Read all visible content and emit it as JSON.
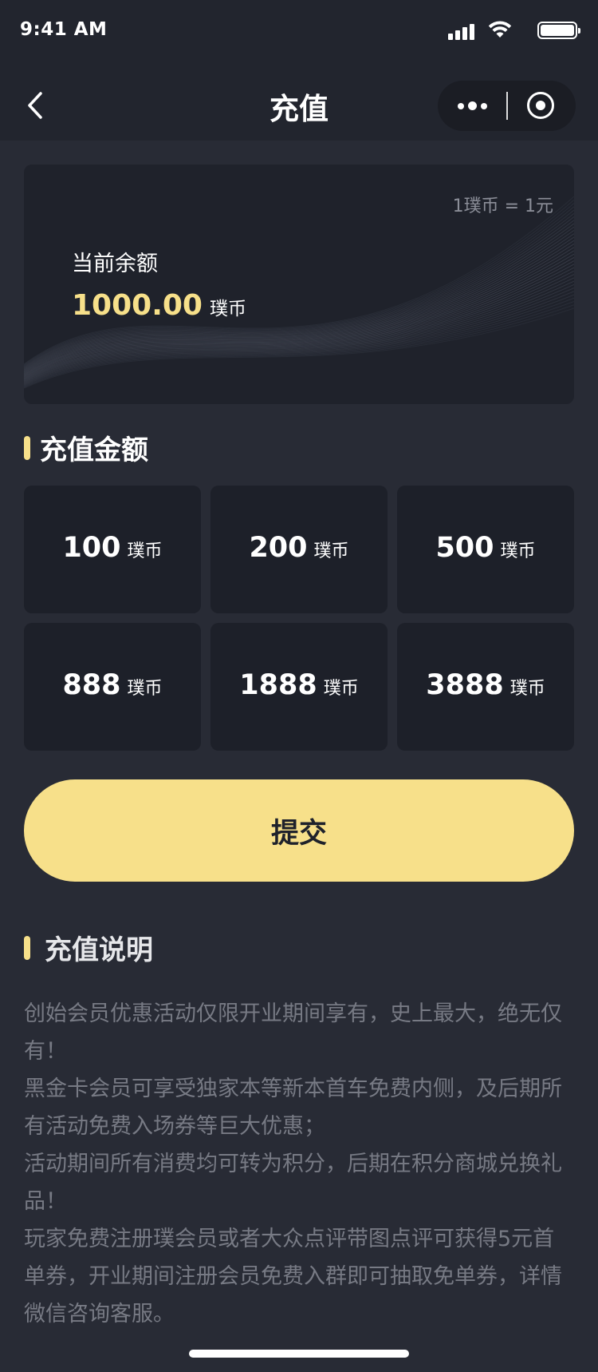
{
  "status_bar": {
    "time": "9:41 AM",
    "icons": [
      "signal-icon",
      "wifi-icon",
      "battery-icon"
    ]
  },
  "nav": {
    "title": "充值",
    "back_icon": "chevron-left-icon",
    "capsule_icons": [
      "more-icon",
      "close-circle-icon"
    ]
  },
  "balance": {
    "rate": "1璞币 = 1元",
    "label": "当前余额",
    "amount": "1000.00",
    "unit": "璞币"
  },
  "recharge_section": {
    "title": "充值金额",
    "options": [
      {
        "value": "100",
        "unit": "璞币"
      },
      {
        "value": "200",
        "unit": "璞币"
      },
      {
        "value": "500",
        "unit": "璞币"
      },
      {
        "value": "888",
        "unit": "璞币"
      },
      {
        "value": "1888",
        "unit": "璞币"
      },
      {
        "value": "3888",
        "unit": "璞币"
      }
    ]
  },
  "submit_label": "提交",
  "notes_section": {
    "title": "充值说明",
    "lines": [
      "创始会员优惠活动仅限开业期间享有，史上最大，绝无仅有！",
      "黑金卡会员可享受独家本等新本首车免费内侧，及后期所有活动免费入场券等巨大优惠；",
      "活动期间所有消费均可转为积分，后期在积分商城兑换礼品！",
      "玩家免费注册璞会员或者大众点评带图点评可获得5元首单券，开业期间注册会员免费入群即可抽取免单券，详情微信咨询客服。"
    ]
  },
  "colors": {
    "background": "#282b35",
    "accent": "#f7e08a",
    "card": "#1d2029",
    "muted_text": "#777a84"
  }
}
